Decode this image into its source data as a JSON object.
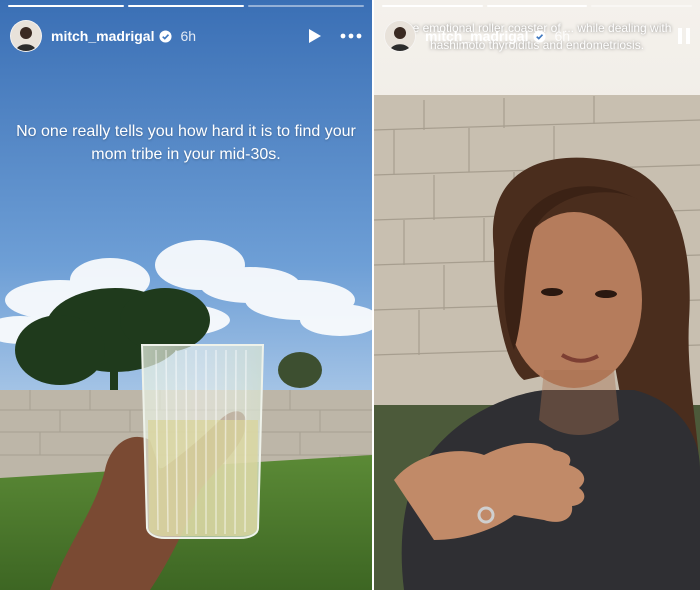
{
  "stories": [
    {
      "username": "mitch_madrigal",
      "time": "6h",
      "caption": "No one really tells you how hard it is to find your mom tribe in your mid-30s.",
      "progress": [
        1,
        1,
        0
      ],
      "controls": {
        "play_icon": "play-icon",
        "more_icon": "more-icon"
      }
    },
    {
      "username": "mitch_madrigal",
      "time": "6h",
      "caption": "the emotional roller coaster of ... while dealing with hashimoto thyroiditis and endometriosis.",
      "progress": [
        1,
        1,
        0
      ],
      "controls": {
        "pause_icon": "pause-icon"
      }
    }
  ],
  "colors": {
    "sky_top": "#3f78bf",
    "sky_bottom": "#cfe0f2",
    "grass": "#4f7a2f",
    "stone": "#bdb6a8",
    "verified": "#3897f0"
  }
}
